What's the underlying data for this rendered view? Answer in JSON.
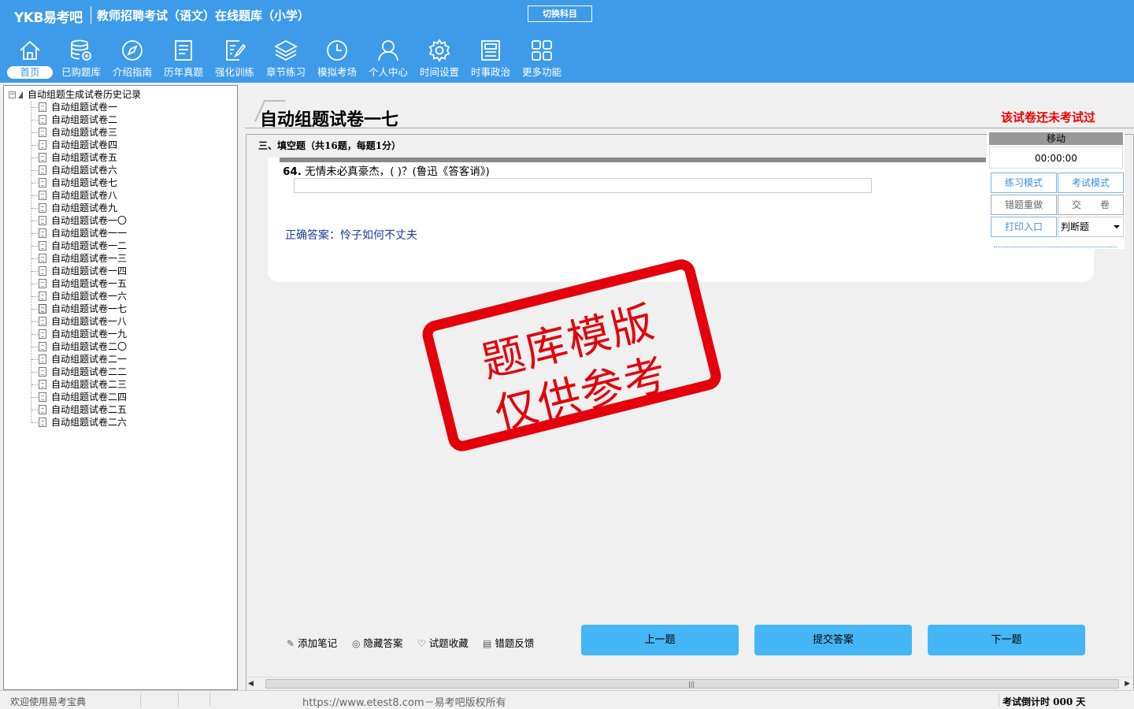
{
  "header": {
    "logo": "YKB易考吧",
    "title": "教师招聘考试（语文）在线题库（小学）",
    "switch_label": "切换科目"
  },
  "nav": {
    "home": "首页",
    "purchased": "已购题库",
    "guide": "介绍指南",
    "past": "历年真题",
    "intensive": "强化训练",
    "chapter": "章节练习",
    "mock": "模拟考场",
    "personal": "个人中心",
    "time": "时间设置",
    "politics": "时事政治",
    "more": "更多功能"
  },
  "tree": {
    "root": "自动组题生成试卷历史记录",
    "items": [
      "自动组题试卷一",
      "自动组题试卷二",
      "自动组题试卷三",
      "自动组题试卷四",
      "自动组题试卷五",
      "自动组题试卷六",
      "自动组题试卷七",
      "自动组题试卷八",
      "自动组题试卷九",
      "自动组题试卷一〇",
      "自动组题试卷一一",
      "自动组题试卷一二",
      "自动组题试卷一三",
      "自动组题试卷一四",
      "自动组题试卷一五",
      "自动组题试卷一六",
      "自动组题试卷一七",
      "自动组题试卷一八",
      "自动组题试卷一九",
      "自动组题试卷二〇",
      "自动组题试卷二一",
      "自动组题试卷二二",
      "自动组题试卷二三",
      "自动组题试卷二四",
      "自动组题试卷二五",
      "自动组题试卷二六"
    ]
  },
  "paper": {
    "title": "自动组题试卷一七",
    "status": "该试卷还未考试过",
    "section": "三、填空题（共16题，每题1分）"
  },
  "question": {
    "number": "64.",
    "text": "无情未必真豪杰，(  )？(鲁迅《答客诮》)",
    "answer_label": "正确答案：",
    "answer": "怜子如何不丈夫"
  },
  "control": {
    "move": "移动",
    "timer": "00:00:00",
    "practice_mode": "练习模式",
    "exam_mode": "考试模式",
    "redo_wrong": "错题重做",
    "submit_paper": "交　　卷",
    "print": "打印入口",
    "type_select": "判断题"
  },
  "stamp": {
    "line1": "题库模版",
    "line2": "仅供参考"
  },
  "tools": {
    "note": "添加笔记",
    "hide_answer": "隐藏答案",
    "favorite": "试题收藏",
    "feedback": "错题反馈"
  },
  "buttons": {
    "prev": "上一题",
    "submit": "提交答案",
    "next": "下一题"
  },
  "status": {
    "welcome": "欢迎使用易考宝典",
    "url": "https://www.etest8.com－易考吧版权所有",
    "countdown": "考试倒计时 000 天"
  },
  "colors": {
    "header_bg": "#3d9be9",
    "button_bg": "#44b6f6",
    "stamp": "#e3000b",
    "answer_text": "#1a3a9e"
  }
}
